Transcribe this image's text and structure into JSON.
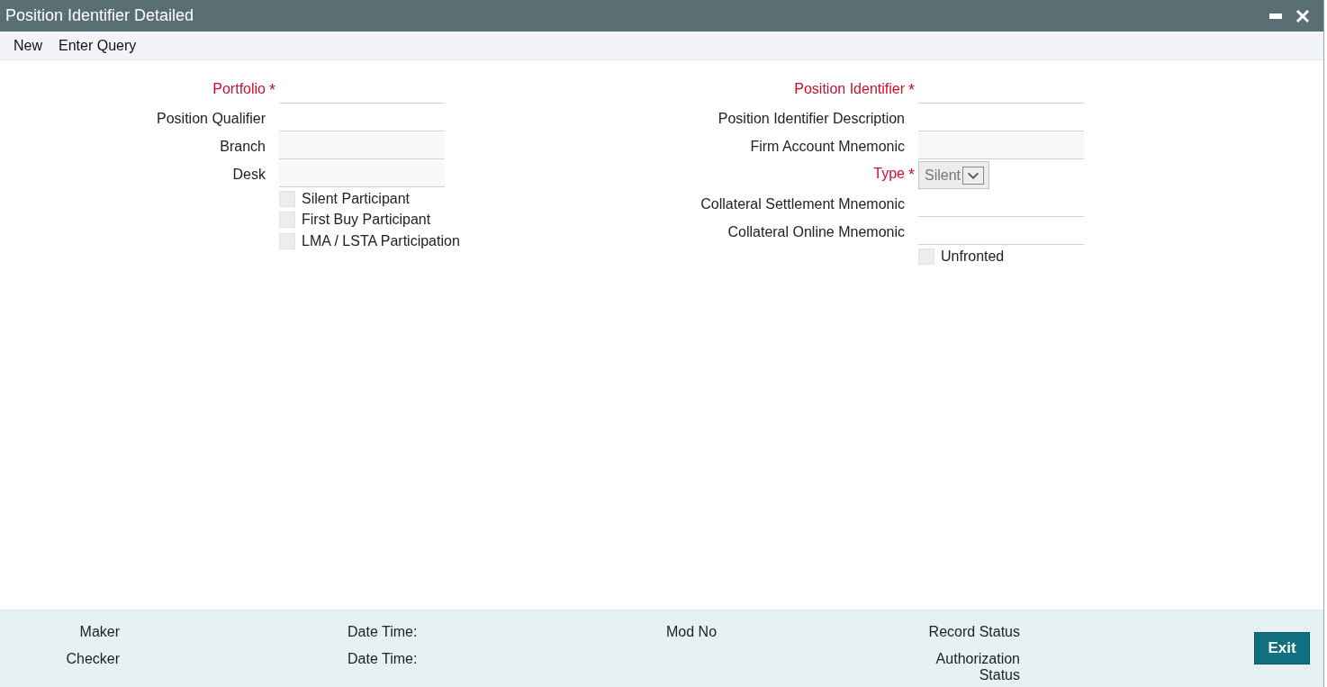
{
  "window": {
    "title": "Position Identifier Detailed"
  },
  "menu": [
    {
      "label": "New"
    },
    {
      "label": "Enter Query"
    }
  ],
  "left_section": {
    "fields": [
      {
        "label": "Portfolio",
        "required": true,
        "mark": "*",
        "kind": "text"
      },
      {
        "label": "Position Qualifier",
        "required": false,
        "kind": "text"
      },
      {
        "label": "Branch",
        "required": false,
        "kind": "readonly"
      },
      {
        "label": "Desk",
        "required": false,
        "kind": "readonly"
      }
    ],
    "checkboxes": [
      {
        "label": "Silent Participant",
        "checked": false
      },
      {
        "label": "First Buy Participant",
        "checked": false
      },
      {
        "label": "LMA / LSTA Participation",
        "checked": false
      }
    ]
  },
  "right_section": {
    "fields": [
      {
        "label": "Position Identifier",
        "required": true,
        "mark": "*",
        "kind": "text"
      },
      {
        "label": "Position Identifier Description",
        "required": false,
        "kind": "text"
      },
      {
        "label": "Firm Account Mnemonic",
        "required": false,
        "kind": "readonly"
      },
      {
        "label": "Type",
        "required": true,
        "mark": "*",
        "kind": "select",
        "value": "Silent"
      },
      {
        "label": "Collateral Settlement Mnemonic",
        "required": false,
        "kind": "text"
      },
      {
        "label": "Collateral Online Mnemonic",
        "required": false,
        "kind": "text"
      }
    ],
    "checkboxes": [
      {
        "label": "Unfronted",
        "checked": false
      }
    ]
  },
  "footer": {
    "columns": [
      [
        "Maker",
        "Checker"
      ],
      [
        "Date Time:",
        "Date Time:"
      ],
      [
        "Mod No"
      ],
      [
        "Record Status",
        "Authorization Status"
      ]
    ],
    "button": "Exit"
  }
}
